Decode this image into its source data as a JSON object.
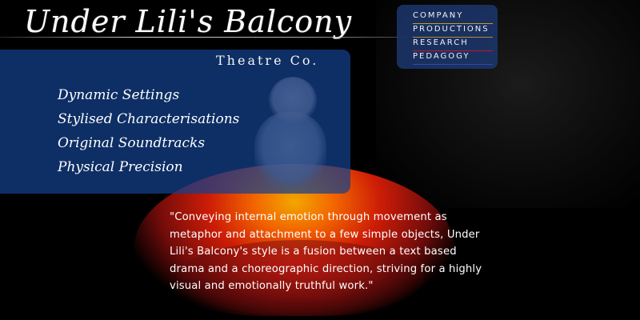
{
  "header": {
    "title": "Under Lili's Balcony",
    "subtitle": "Theatre Co."
  },
  "features": [
    "Dynamic Settings",
    "Stylised Characterisations",
    "Original Soundtracks",
    "Physical Precision"
  ],
  "nav": {
    "items": [
      {
        "label": "COMPANY",
        "rule_color": "#c49a2b"
      },
      {
        "label": "PRODUCTIONS",
        "rule_color": "#b88a34"
      },
      {
        "label": "RESEARCH",
        "rule_color": "#c4162a"
      },
      {
        "label": "PEDAGOGY",
        "rule_color": "#2d47b8"
      }
    ]
  },
  "quote": {
    "text": "\"Conveying internal emotion through movement as metaphor and attachment to a few simple objects, Under Lili's Balcony's style is a fusion between a text based drama and a choreographic direction, striving for a highly visual and emotionally truthful work.\""
  },
  "colors": {
    "panel_blue": "#14418c",
    "nav_blue": "#1c376e",
    "background": "#000000"
  },
  "icons": {
    "hero": "dancer-in-red-dress-image"
  }
}
